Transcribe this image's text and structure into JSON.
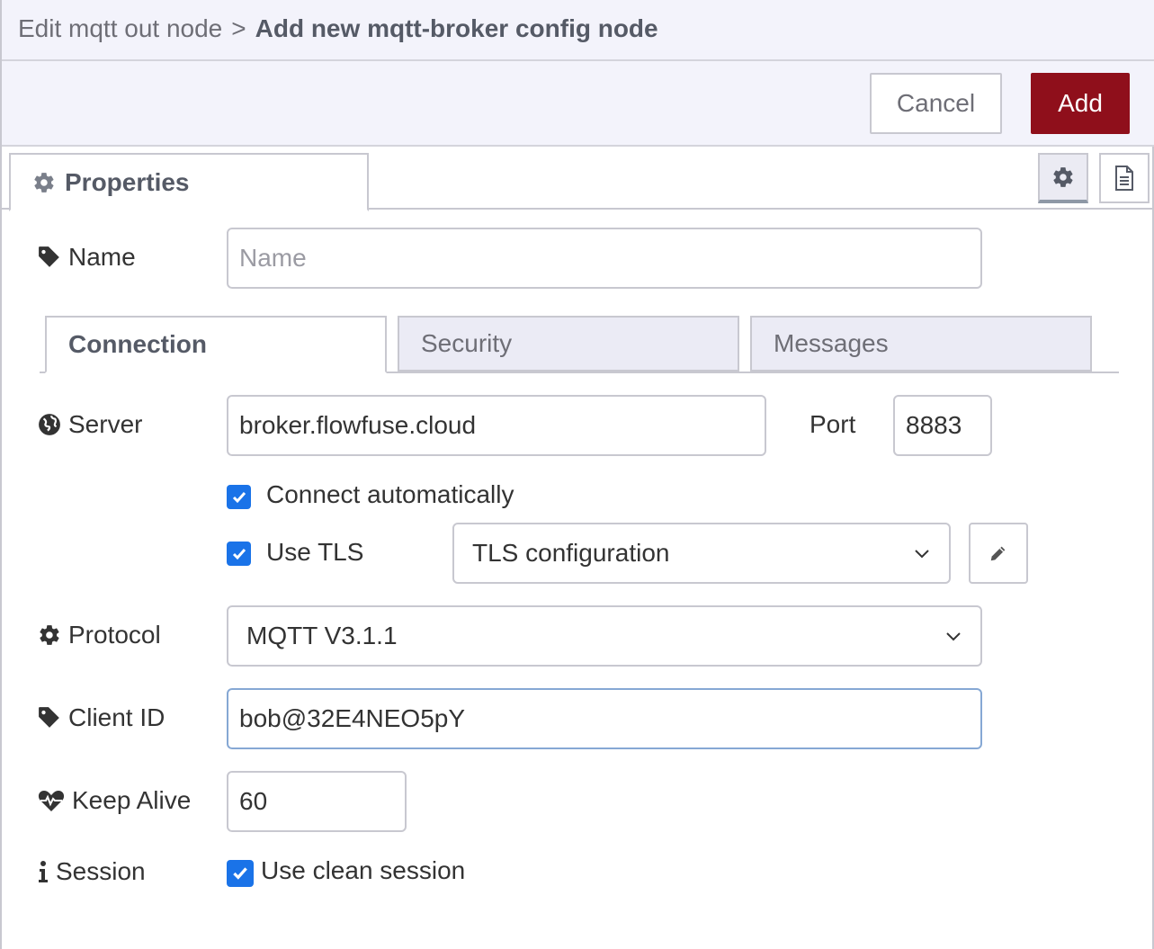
{
  "breadcrumb": {
    "parent": "Edit mqtt out node",
    "separator": ">",
    "current": "Add new mqtt-broker config node"
  },
  "toolbar": {
    "cancel_label": "Cancel",
    "add_label": "Add"
  },
  "tray_tabs": {
    "properties_label": "Properties"
  },
  "form": {
    "name": {
      "label": "Name",
      "placeholder": "Name",
      "value": ""
    },
    "tabs": [
      "Connection",
      "Security",
      "Messages"
    ],
    "server": {
      "label": "Server",
      "value": "broker.flowfuse.cloud"
    },
    "port": {
      "label": "Port",
      "value": "8883"
    },
    "connect_auto": {
      "label": "Connect automatically",
      "checked": true
    },
    "use_tls": {
      "label": "Use TLS",
      "checked": true
    },
    "tls_config": {
      "selected": "TLS configuration"
    },
    "protocol": {
      "label": "Protocol",
      "selected": "MQTT V3.1.1"
    },
    "client_id": {
      "label": "Client ID",
      "value": "bob@32E4NEO5pY"
    },
    "keep_alive": {
      "label": "Keep Alive",
      "value": "60"
    },
    "session": {
      "label": "Session",
      "checkbox_label": "Use clean session",
      "checked": true
    }
  },
  "colors": {
    "accent": "#8f0f1b",
    "checkbox": "#1a73e8",
    "header_bg": "#f3f3fb"
  }
}
